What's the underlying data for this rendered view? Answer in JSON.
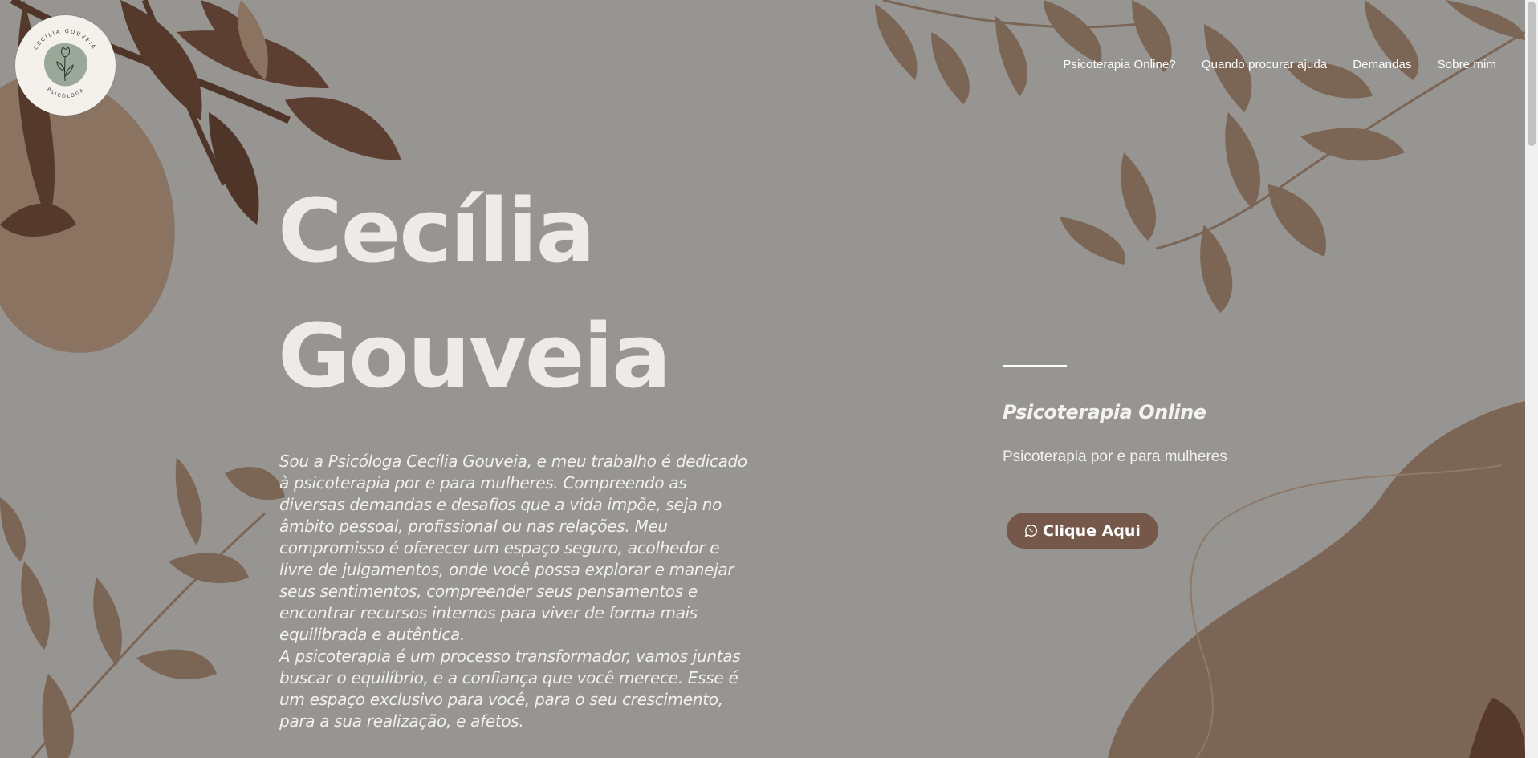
{
  "logo": {
    "top_text": "CECÍLIA GOUVEIA",
    "bottom_text": "PSICÓLOGA",
    "icon": "tulip-icon"
  },
  "nav": {
    "items": [
      "Psicoterapia Online?",
      "Quando procurar ajuda",
      "Demandas",
      "Sobre mim"
    ]
  },
  "hero": {
    "name_line1": "Cecília",
    "name_line2": "Gouveia",
    "bio_paragraphs": [
      "Sou a Psicóloga Cecília Gouveia, e meu trabalho é dedicado à psicoterapia por e para mulheres. Compreendo as diversas demandas e desafios que a vida impõe, seja no âmbito pessoal, profissional ou nas relações. Meu compromisso é oferecer um espaço seguro, acolhedor e livre de julgamentos, onde você possa explorar e manejar seus sentimentos, compreender seus pensamentos e encontrar recursos internos para viver de forma mais equilibrada e autêntica.",
      "A psicoterapia é um processo transformador, vamos juntas buscar o equilíbrio, e a confiança que você merece. Esse é um espaço exclusivo para você, para o seu crescimento, para a sua realização, e afetos."
    ]
  },
  "aside": {
    "title": "Psicoterapia Online",
    "subtitle": "Psicoterapia por e para mulheres",
    "cta_label": "Clique Aqui",
    "cta_icon": "whatsapp-icon"
  },
  "colors": {
    "background": "#979591",
    "leaf_dark": "#5a3d2e",
    "leaf_mid": "#7b6655",
    "leaf_light": "#8a7361",
    "button": "#76584a",
    "text_light": "#ecebe7"
  }
}
